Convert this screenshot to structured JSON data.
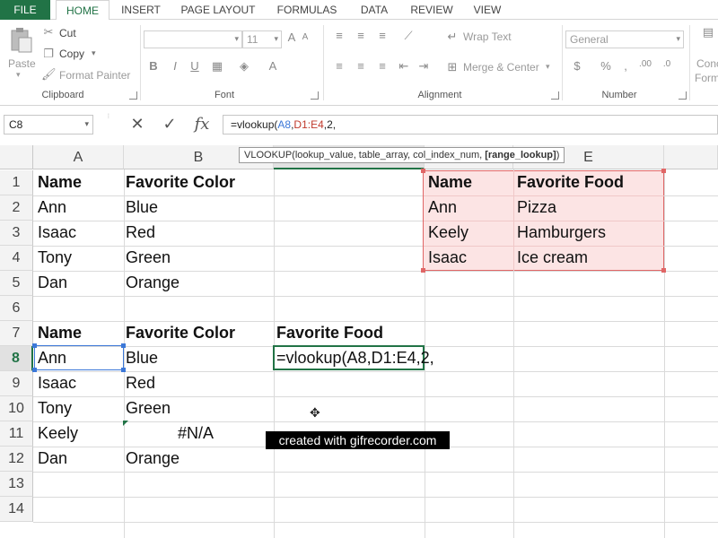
{
  "tabs": [
    "FILE",
    "HOME",
    "INSERT",
    "PAGE LAYOUT",
    "FORMULAS",
    "DATA",
    "REVIEW",
    "VIEW"
  ],
  "active_tab": "HOME",
  "clipboard": {
    "paste": "Paste",
    "cut": "Cut",
    "copy": "Copy",
    "format_painter": "Format Painter",
    "label": "Clipboard"
  },
  "font": {
    "size": "11",
    "label": "Font"
  },
  "alignment": {
    "wrap_text": "Wrap Text",
    "merge_center": "Merge & Center",
    "label": "Alignment"
  },
  "number": {
    "format": "General",
    "label": "Number",
    "currency": "$",
    "percent": "%"
  },
  "styles": {
    "cond_1": "Conc",
    "cond_2": "Form"
  },
  "formula_bar": {
    "name_box": "C8",
    "formula_prefix": "=vlookup(",
    "formula_ref1": "A8",
    "formula_sep": ",",
    "formula_ref2": "D1:E4",
    "formula_suffix": ",2,"
  },
  "tooltip": {
    "fn": "VLOOKUP(",
    "args": "lookup_value, table_array, col_index_num, ",
    "opt": "[range_lookup]",
    "close": ")"
  },
  "columns": [
    "A",
    "B",
    "",
    "",
    "E"
  ],
  "rows": [
    "1",
    "2",
    "3",
    "4",
    "5",
    "6",
    "7",
    "8",
    "9",
    "10",
    "11",
    "12",
    "13",
    "14"
  ],
  "cells": {
    "A1": "Name",
    "B1": "Favorite Color",
    "D1": "Name",
    "E1": "Favorite Food",
    "A2": "Ann",
    "B2": "Blue",
    "D2": "Ann",
    "E2": "Pizza",
    "A3": "Isaac",
    "B3": "Red",
    "D3": "Keely",
    "E3": "Hamburgers",
    "A4": "Tony",
    "B4": "Green",
    "D4": "Isaac",
    "E4": "Ice cream",
    "A5": "Dan",
    "B5": "Orange",
    "A7": "Name",
    "B7": "Favorite Color",
    "C7": "Favorite Food",
    "A8": "Ann",
    "B8": "Blue",
    "C8": "=vlookup(A8,D1:E4,2,",
    "A9": "Isaac",
    "B9": "Red",
    "A10": "Tony",
    "B10": "Green",
    "A11": "Keely",
    "B11": "#N/A",
    "A12": "Dan",
    "B12": "Orange"
  },
  "watermark": "created with gifrecorder.com"
}
